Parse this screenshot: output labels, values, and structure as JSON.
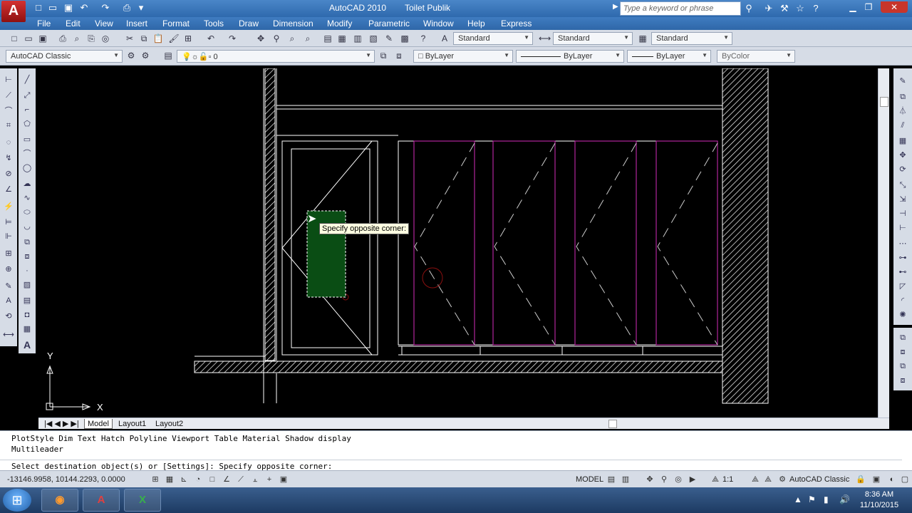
{
  "window": {
    "app_title": "AutoCAD 2010",
    "file_name": "Toilet Publik",
    "search_placeholder": "Type a keyword or phrase",
    "logo": "A"
  },
  "menu": [
    "File",
    "Edit",
    "View",
    "Insert",
    "Format",
    "Tools",
    "Draw",
    "Dimension",
    "Modify",
    "Parametric",
    "Window",
    "Help",
    "Express"
  ],
  "toolbar": {
    "text_style": "Standard",
    "dim_style": "Standard",
    "table_style": "Standard"
  },
  "properties_bar": {
    "workspace": "AutoCAD Classic",
    "layer": "0",
    "color": "ByLayer",
    "linetype": "ByLayer",
    "lineweight": "ByLayer",
    "plotstyle": "ByColor"
  },
  "canvas": {
    "tooltip": "Specify opposite corner:",
    "ucs_x": "X",
    "ucs_y": "Y"
  },
  "tabs": [
    "Model",
    "Layout1",
    "Layout2"
  ],
  "command": {
    "line1": "PlotStyle Dim Text Hatch Polyline Viewport Table Material Shadow display",
    "line2": "Multileader",
    "prompt": "Select destination object(s) or [Settings]: Specify opposite corner:"
  },
  "status": {
    "coordinates": "-13146.9958, 10144.2293, 0.0000",
    "mode": "MODEL",
    "scale": "1:1",
    "workspace": "AutoCAD Classic"
  },
  "taskbar": {
    "time": "8:36 AM",
    "date": "11/10/2015"
  },
  "colors": {
    "titlebar": "#3a78bd",
    "canvas": "#000000",
    "partition": "#b0259b",
    "selection": "#0a4d14",
    "tooltip_bg": "#ffffe1"
  },
  "icons": {
    "start": "windows-start-icon",
    "firefox": "firefox-icon",
    "autocad": "autocad-icon",
    "excel": "excel-icon"
  }
}
